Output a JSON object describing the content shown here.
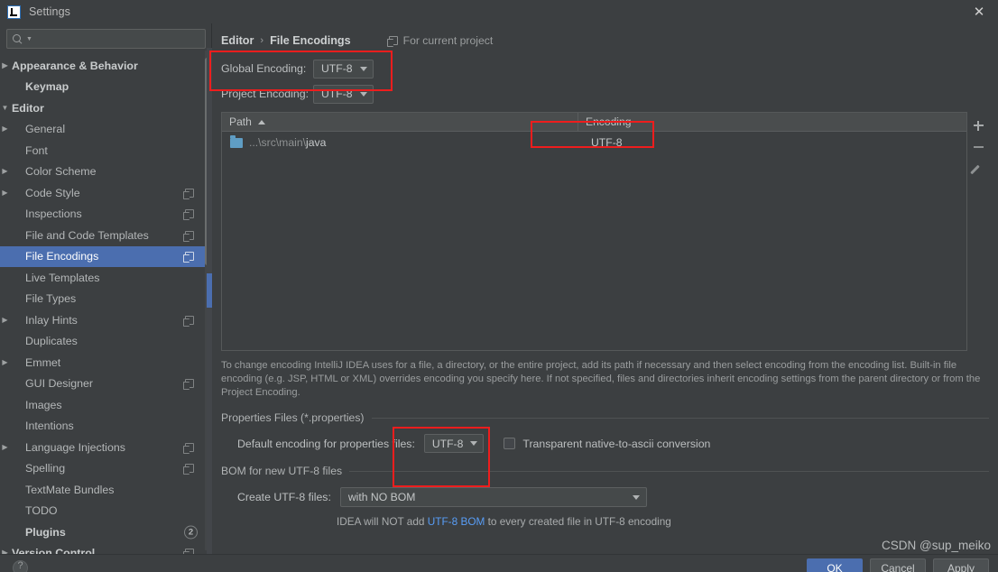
{
  "window": {
    "title": "Settings",
    "logo_icon": "intellij-idea-logo-icon",
    "close_icon": "close-icon"
  },
  "sidebar": {
    "search": {
      "placeholder": "",
      "value": "",
      "icon": "search-icon"
    },
    "items": [
      {
        "label": "Appearance & Behavior",
        "arrow": "right",
        "indent": 0,
        "bold": true,
        "badge": null,
        "copy": false,
        "selected": false
      },
      {
        "label": "Keymap",
        "arrow": "none",
        "indent": 1,
        "bold": true,
        "badge": null,
        "copy": false,
        "selected": false
      },
      {
        "label": "Editor",
        "arrow": "down",
        "indent": 0,
        "bold": true,
        "badge": null,
        "copy": false,
        "selected": false
      },
      {
        "label": "General",
        "arrow": "right",
        "indent": 1,
        "bold": false,
        "badge": null,
        "copy": false,
        "selected": false
      },
      {
        "label": "Font",
        "arrow": "none",
        "indent": 1,
        "bold": false,
        "badge": null,
        "copy": false,
        "selected": false
      },
      {
        "label": "Color Scheme",
        "arrow": "right",
        "indent": 1,
        "bold": false,
        "badge": null,
        "copy": false,
        "selected": false
      },
      {
        "label": "Code Style",
        "arrow": "right",
        "indent": 1,
        "bold": false,
        "badge": null,
        "copy": true,
        "selected": false
      },
      {
        "label": "Inspections",
        "arrow": "none",
        "indent": 1,
        "bold": false,
        "badge": null,
        "copy": true,
        "selected": false
      },
      {
        "label": "File and Code Templates",
        "arrow": "none",
        "indent": 1,
        "bold": false,
        "badge": null,
        "copy": true,
        "selected": false
      },
      {
        "label": "File Encodings",
        "arrow": "none",
        "indent": 1,
        "bold": false,
        "badge": null,
        "copy": true,
        "selected": true
      },
      {
        "label": "Live Templates",
        "arrow": "none",
        "indent": 1,
        "bold": false,
        "badge": null,
        "copy": false,
        "selected": false
      },
      {
        "label": "File Types",
        "arrow": "none",
        "indent": 1,
        "bold": false,
        "badge": null,
        "copy": false,
        "selected": false
      },
      {
        "label": "Inlay Hints",
        "arrow": "right",
        "indent": 1,
        "bold": false,
        "badge": null,
        "copy": true,
        "selected": false
      },
      {
        "label": "Duplicates",
        "arrow": "none",
        "indent": 1,
        "bold": false,
        "badge": null,
        "copy": false,
        "selected": false
      },
      {
        "label": "Emmet",
        "arrow": "right",
        "indent": 1,
        "bold": false,
        "badge": null,
        "copy": false,
        "selected": false
      },
      {
        "label": "GUI Designer",
        "arrow": "none",
        "indent": 1,
        "bold": false,
        "badge": null,
        "copy": true,
        "selected": false
      },
      {
        "label": "Images",
        "arrow": "none",
        "indent": 1,
        "bold": false,
        "badge": null,
        "copy": false,
        "selected": false
      },
      {
        "label": "Intentions",
        "arrow": "none",
        "indent": 1,
        "bold": false,
        "badge": null,
        "copy": false,
        "selected": false
      },
      {
        "label": "Language Injections",
        "arrow": "right",
        "indent": 1,
        "bold": false,
        "badge": null,
        "copy": true,
        "selected": false
      },
      {
        "label": "Spelling",
        "arrow": "none",
        "indent": 1,
        "bold": false,
        "badge": null,
        "copy": true,
        "selected": false
      },
      {
        "label": "TextMate Bundles",
        "arrow": "none",
        "indent": 1,
        "bold": false,
        "badge": null,
        "copy": false,
        "selected": false
      },
      {
        "label": "TODO",
        "arrow": "none",
        "indent": 1,
        "bold": false,
        "badge": null,
        "copy": false,
        "selected": false
      },
      {
        "label": "Plugins",
        "arrow": "none",
        "indent": 1,
        "bold": true,
        "badge": "2",
        "copy": false,
        "selected": false
      },
      {
        "label": "Version Control",
        "arrow": "right",
        "indent": 0,
        "bold": true,
        "badge": null,
        "copy": true,
        "selected": false
      }
    ]
  },
  "main": {
    "breadcrumb": {
      "parent": "Editor",
      "separator": "›",
      "current": "File Encodings"
    },
    "scope_note": {
      "icon": "copy-scope-icon",
      "text": "For current project"
    },
    "global_encoding": {
      "label": "Global Encoding:",
      "value": "UTF-8"
    },
    "project_encoding": {
      "label": "Project Encoding:",
      "value": "UTF-8"
    },
    "table": {
      "columns": [
        "Path",
        "Encoding"
      ],
      "sort_column": "Path",
      "sort_direction": "asc",
      "rows": [
        {
          "path_prefix": "...\\src\\main\\",
          "path_name": "java",
          "encoding": "UTF-8",
          "icon": "folder-icon"
        }
      ],
      "toolbar": [
        {
          "name": "add-row-button",
          "icon": "plus-icon"
        },
        {
          "name": "remove-row-button",
          "icon": "minus-icon"
        },
        {
          "name": "edit-row-button",
          "icon": "pencil-icon"
        }
      ]
    },
    "description": "To change encoding IntelliJ IDEA uses for a file, a directory, or the entire project, add its path if necessary and then select encoding from the encoding list. Built-in file encoding (e.g. JSP, HTML or XML) overrides encoding you specify here. If not specified, files and directories inherit encoding settings from the parent directory or from the Project Encoding.",
    "properties_group": {
      "title": "Properties Files (*.properties)",
      "default_encoding_label": "Default encoding for properties files:",
      "default_encoding_value": "UTF-8",
      "checkbox_label": "Transparent native-to-ascii conversion",
      "checkbox_checked": false
    },
    "bom_group": {
      "title": "BOM for new UTF-8 files",
      "create_label": "Create UTF-8 files:",
      "create_value": "with NO BOM",
      "note_before": "IDEA will NOT add ",
      "note_link": "UTF-8 BOM",
      "note_after": " to every created file in UTF-8 encoding"
    }
  },
  "footer": {
    "help_icon": "help-icon",
    "buttons": [
      {
        "label": "OK",
        "primary": true
      },
      {
        "label": "Cancel",
        "primary": false
      },
      {
        "label": "Apply",
        "primary": false
      }
    ],
    "watermark": "CSDN @sup_meiko"
  },
  "colors": {
    "accent": "#4b6eaf",
    "highlight_box": "#ee1d1d",
    "link": "#589df6",
    "background": "#3c3f41",
    "folder": "#5f9dc4"
  }
}
